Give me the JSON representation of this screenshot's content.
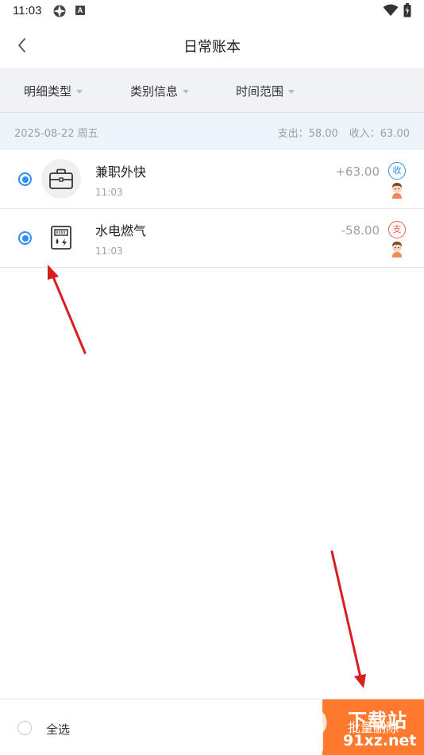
{
  "status_bar": {
    "time": "11:03",
    "a_badge": "A",
    "icons": [
      "gear-icon",
      "a-icon",
      "wifi-icon",
      "battery-icon"
    ]
  },
  "header": {
    "title": "日常账本",
    "back_icon": "chevron-left-icon"
  },
  "filters": [
    {
      "label": "明细类型"
    },
    {
      "label": "类别信息"
    },
    {
      "label": "时间范围"
    }
  ],
  "date_group": {
    "date": "2025-08-22 周五",
    "expense_summary": "支出：58.00",
    "income_summary": "收入：63.00"
  },
  "records": [
    {
      "title": "兼职外快",
      "time": "11:03",
      "amount": "+63.00",
      "type_badge": "收",
      "icon": "briefcase-icon",
      "selected": true
    },
    {
      "title": "水电燃气",
      "time": "11:03",
      "amount": "-58.00",
      "type_badge": "支",
      "icon": "utility-meter-icon",
      "selected": true
    }
  ],
  "bottom_bar": {
    "select_all_label": "全选",
    "batch_delete_label": "批量删除"
  },
  "watermark": {
    "line1": "下载站",
    "line2": "91xz.net"
  },
  "colors": {
    "accent_blue": "#2e8ff0",
    "expense_red": "#ef5b4b",
    "delete_orange": "#ff7a2e",
    "annotation_arrow": "#d81e1e"
  }
}
